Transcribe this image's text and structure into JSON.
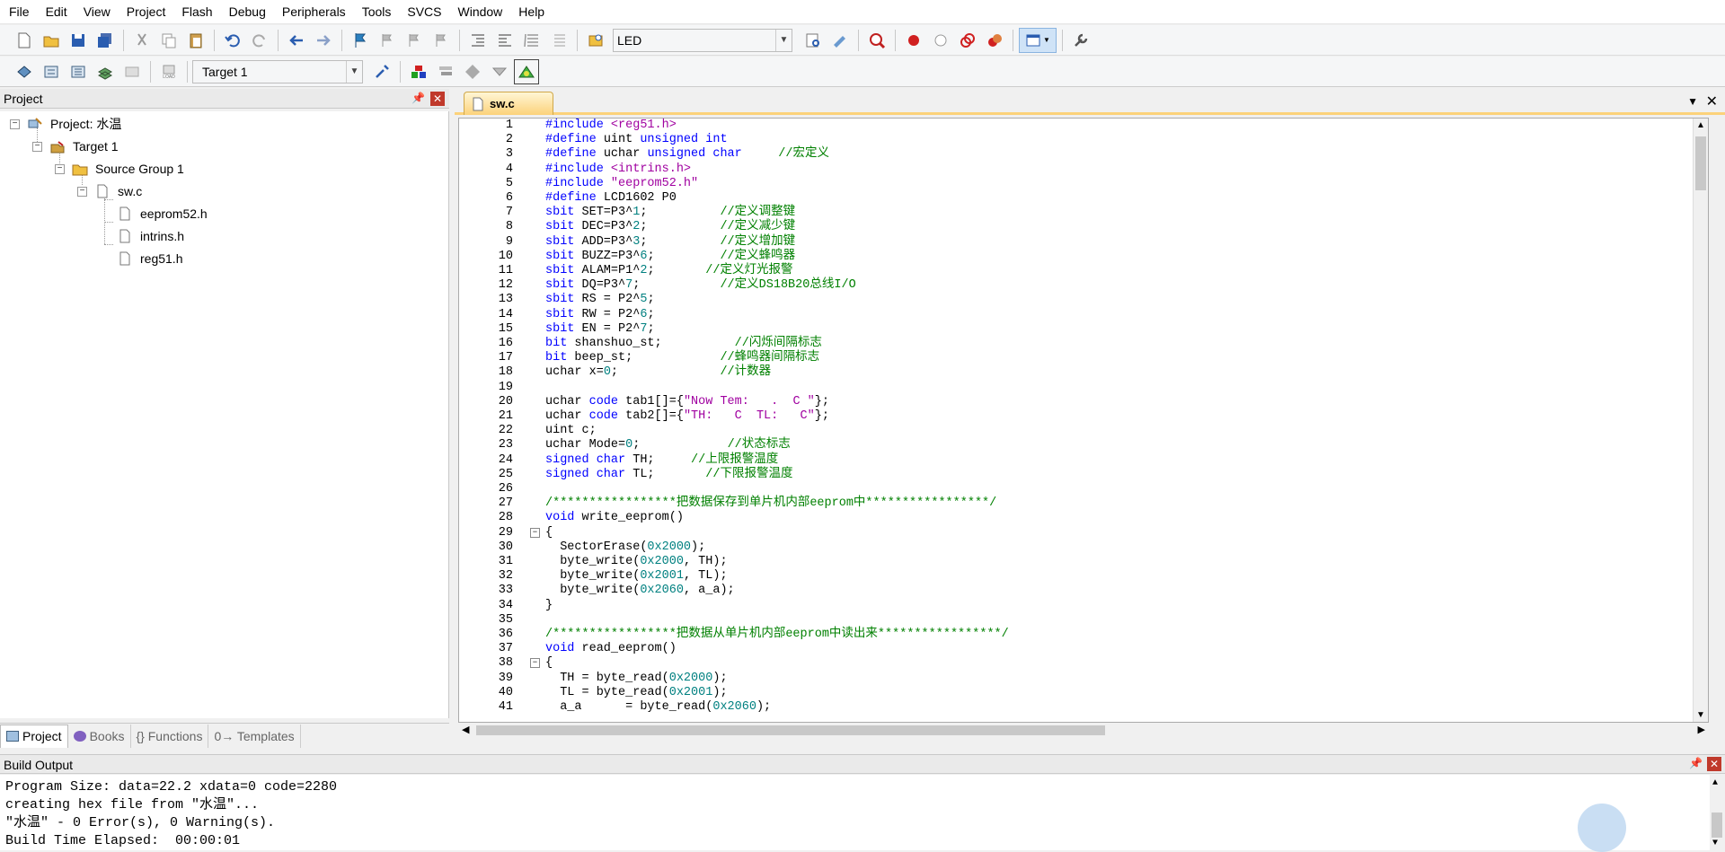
{
  "menu": [
    "File",
    "Edit",
    "View",
    "Project",
    "Flash",
    "Debug",
    "Peripherals",
    "Tools",
    "SVCS",
    "Window",
    "Help"
  ],
  "toolbar": {
    "target_combo_1": "LED",
    "target_combo_2": "Target 1"
  },
  "project_panel": {
    "title": "Project",
    "tree": [
      {
        "label": "Project: 水温",
        "level": 0
      },
      {
        "label": "Target 1",
        "level": 1
      },
      {
        "label": "Source Group 1",
        "level": 2
      },
      {
        "label": "sw.c",
        "level": 3
      },
      {
        "label": "eeprom52.h",
        "level": 4
      },
      {
        "label": "intrins.h",
        "level": 4
      },
      {
        "label": "reg51.h",
        "level": 4
      }
    ],
    "tabs": [
      "Project",
      "Books",
      "{} Functions",
      "0→ Templates"
    ]
  },
  "editor": {
    "tab": "sw.c",
    "lines": [
      "1",
      "2",
      "3",
      "4",
      "5",
      "6",
      "7",
      "8",
      "9",
      "10",
      "11",
      "12",
      "13",
      "14",
      "15",
      "16",
      "17",
      "18",
      "19",
      "20",
      "21",
      "22",
      "23",
      "24",
      "25",
      "26",
      "27",
      "28",
      "29",
      "30",
      "31",
      "32",
      "33",
      "34",
      "35",
      "36",
      "37",
      "38",
      "39",
      "40",
      "41"
    ]
  },
  "build": {
    "title": "Build Output",
    "lines": [
      "Program Size: data=22.2 xdata=0 code=2280",
      "creating hex file from \"水温\"...",
      "\"水温\" - 0 Error(s), 0 Warning(s).",
      "Build Time Elapsed:  00:00:01"
    ]
  },
  "colors": {
    "keyword": "#0000ff",
    "comment": "#008000",
    "string": "#a000a0",
    "number": "#008080",
    "active_tab": "#fcd27a"
  }
}
